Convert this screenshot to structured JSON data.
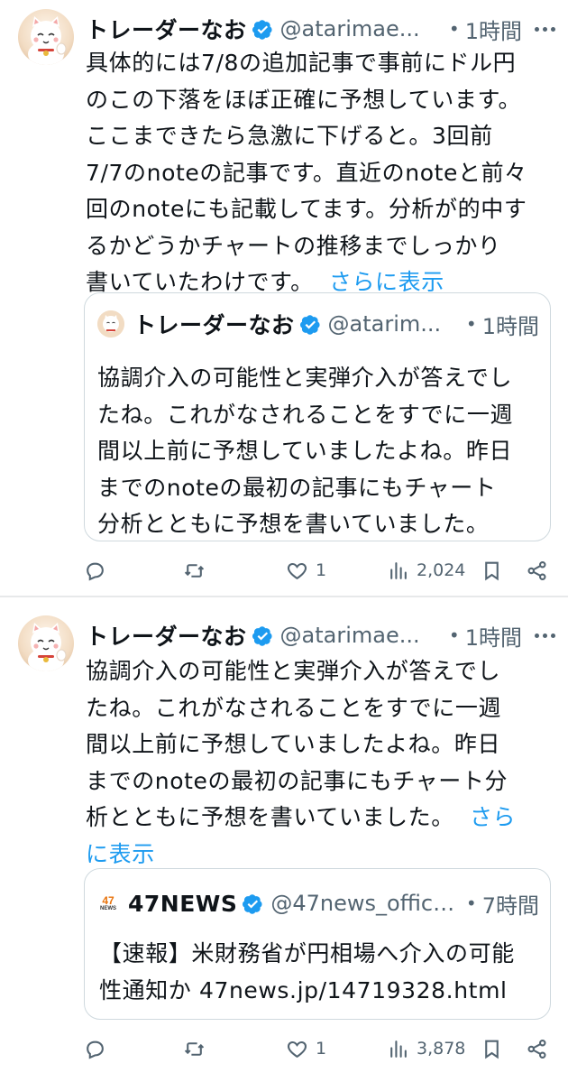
{
  "tweets": [
    {
      "author": {
        "name": "トレーダーなお",
        "handle": "@atarimae...",
        "time": "1時間"
      },
      "text_lines": [
        "具体的には7/8の追加記事で事前にドル円",
        "のこの下落をほぼ正確に予想しています。",
        "ここまできたら急激に下げると。3回前",
        "7/7のnoteの記事です。直近のnoteと前々",
        "回のnoteにも記載してます。分析が的中す",
        "るかどうかチャートの推移までしっかり"
      ],
      "last_line": "書いていたわけです。",
      "show_more": "さらに表示",
      "quote": {
        "name": "トレーダーなお",
        "handle": "@atarim...",
        "time": "1時間",
        "text_lines": [
          "協調介入の可能性と実弾介入が答えでし",
          "たね。これがなされることをすでに一週",
          "間以上前に予想していましたよね。昨日",
          "までのnoteの最初の記事にもチャート",
          "分析とともに予想を書いていました。"
        ]
      },
      "actions": {
        "replies": "",
        "retweets": "",
        "likes": "1",
        "views": "2,024"
      }
    },
    {
      "author": {
        "name": "トレーダーなお",
        "handle": "@atarimae...",
        "time": "1時間"
      },
      "text_lines": [
        "協調介入の可能性と実弾介入が答えでし",
        "たね。これがなされることをすでに一週",
        "間以上前に予想していましたよね。昨日",
        "までのnoteの最初の記事にもチャート分"
      ],
      "line5": "析とともに予想を書いていました。",
      "show_more_a": "さら",
      "show_more_b": "に表示",
      "quote": {
        "logo_top": "47",
        "logo_bottom": "NEWS",
        "name": "47NEWS",
        "handle": "@47news_offici...",
        "time": "7時間",
        "text_lines": [
          "【速報】米財務省が円相場へ介入の可能",
          "性通知か 47news.jp/14719328.html"
        ]
      },
      "actions": {
        "replies": "",
        "retweets": "",
        "likes": "1",
        "views": "3,878"
      }
    }
  ],
  "separator": "•",
  "colors": {
    "link": "#1d9bf0",
    "muted": "#536471",
    "verified": "#1d9bf0",
    "border": "#cfd9de"
  }
}
